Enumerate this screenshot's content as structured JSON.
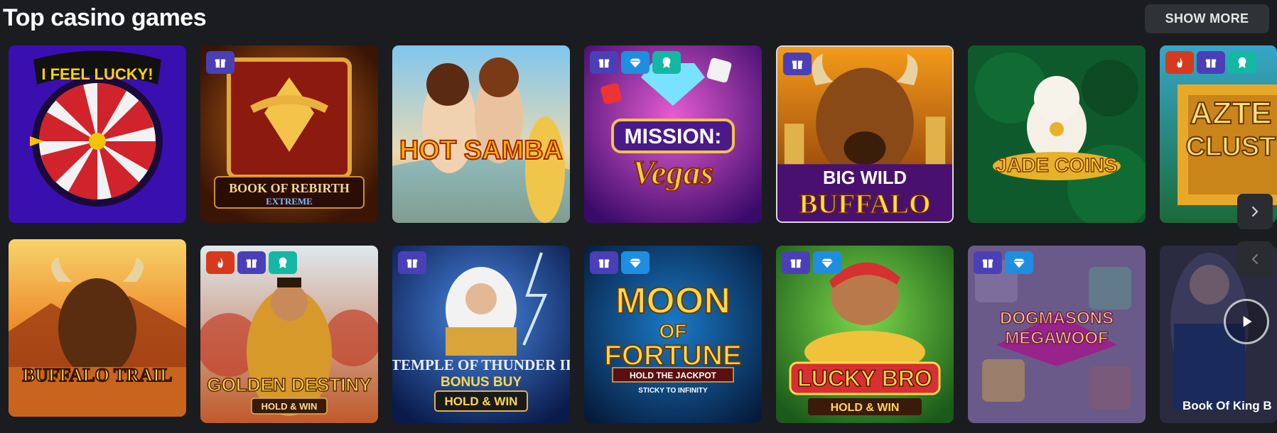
{
  "header": {
    "title": "Top casino games",
    "show_more_label": "SHOW MORE"
  },
  "games": [
    {
      "id": "i-feel-lucky",
      "title": "I FEEL LUCKY!",
      "badges": []
    },
    {
      "id": "book-of-rebirth",
      "title": "BOOK OF REBIRTH",
      "subtitle": "EXTREME",
      "badges": [
        "gift"
      ]
    },
    {
      "id": "hot-samba",
      "title": "HOT SAMBA",
      "badges": []
    },
    {
      "id": "mission-vegas",
      "title": "MISSION: Vegas",
      "badges": [
        "gift",
        "gem",
        "award"
      ]
    },
    {
      "id": "big-wild-buffalo",
      "title": "BIG WILD",
      "subtitle": "BUFFALO",
      "badges": [
        "gift"
      ]
    },
    {
      "id": "jade-coins",
      "title": "JADE COINS",
      "badges": []
    },
    {
      "id": "aztec-cluster",
      "title": "AZTEC CLUSTER",
      "badges": [
        "hot",
        "gift",
        "award"
      ]
    },
    {
      "id": "buffalo-trail",
      "title": "BUFFALO TRAIL",
      "badges": []
    },
    {
      "id": "golden-destiny",
      "title": "GOLDEN DESTINY",
      "subtitle": "HOLD & WIN",
      "badges": [
        "hot",
        "gift",
        "award"
      ]
    },
    {
      "id": "temple-of-thunder",
      "title": "TEMPLE OF THUNDER II",
      "subtitle": "BONUS BUY",
      "tag": "HOLD & WIN",
      "badges": [
        "gift"
      ]
    },
    {
      "id": "moon-of-fortune",
      "title": "MOON OF FORTUNE",
      "subtitle": "HOLD THE JACKPOT",
      "tag": "STICKY TO INFINITY",
      "badges": [
        "gift",
        "gem"
      ]
    },
    {
      "id": "lucky-bro",
      "title": "LUCKY BRO",
      "subtitle": "HOLD & WIN",
      "badges": [
        "gift",
        "gem"
      ]
    },
    {
      "id": "dogmasons",
      "title": "DOGMASONS",
      "subtitle": "MEGAWOOF",
      "badges": [
        "gift",
        "gem"
      ]
    },
    {
      "id": "book-of-king-b",
      "title": "Book Of King B",
      "badges": []
    }
  ],
  "icons": {
    "gift": "gift-icon",
    "gem": "gem-icon",
    "award": "award-icon",
    "hot": "flame-icon",
    "next": "chevron-right-icon",
    "prev": "chevron-left-icon",
    "play": "play-icon"
  },
  "colors": {
    "background": "#1a1c20",
    "button": "#2f3237",
    "badge_gift": "#4b3fb8",
    "badge_gem": "#1f8ee0",
    "badge_award": "#14b7a4",
    "badge_hot": "#d63a1c"
  }
}
